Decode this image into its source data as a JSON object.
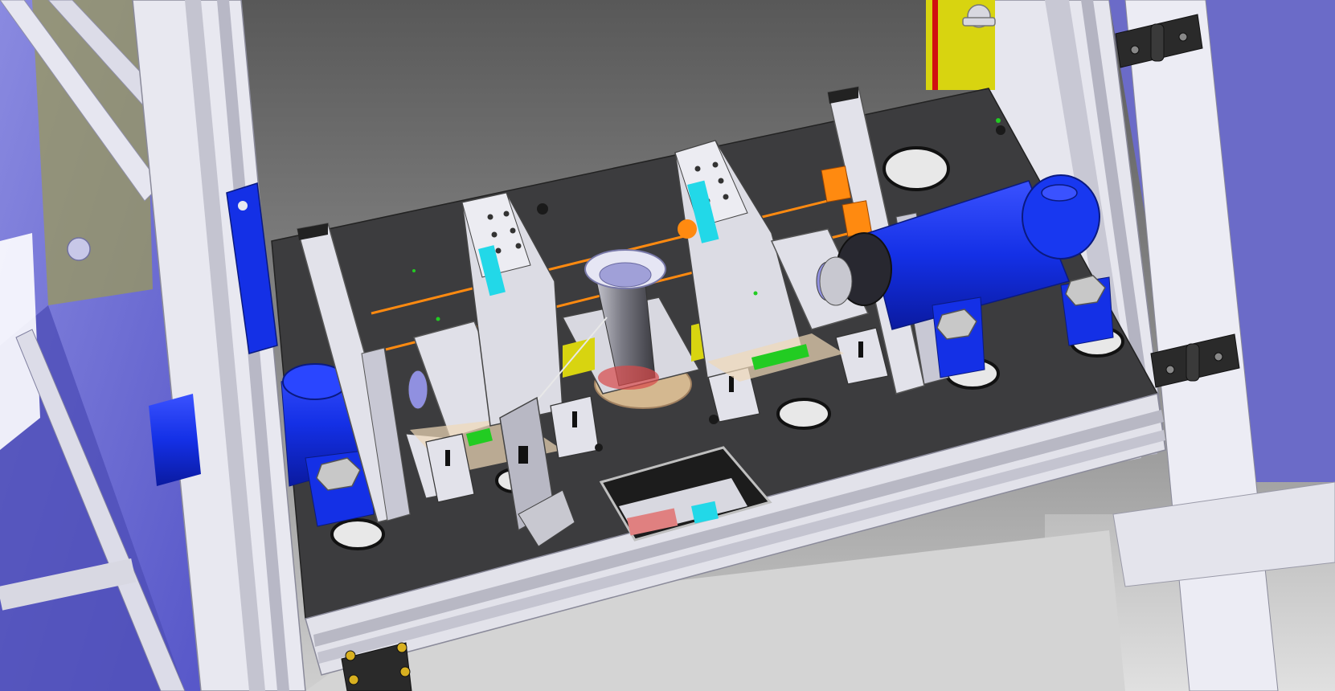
{
  "viewport": {
    "kind": "3d-cad-model-view",
    "label": "",
    "colors": {
      "background_top": "#5c5c5c",
      "background_bottom": "#c8c8c8",
      "frame_aluminum": "#e4e4ec",
      "glass_panel": "#7a7ad8",
      "base_plate": "#3c3c3e",
      "cylinder_blue": "#1430e6",
      "orange_laser": "#ff8a10",
      "yellow_plate": "#d8d410",
      "cyan_part": "#22d8e8",
      "green_part": "#22cc22",
      "hinge_black": "#2a2a2a"
    }
  }
}
